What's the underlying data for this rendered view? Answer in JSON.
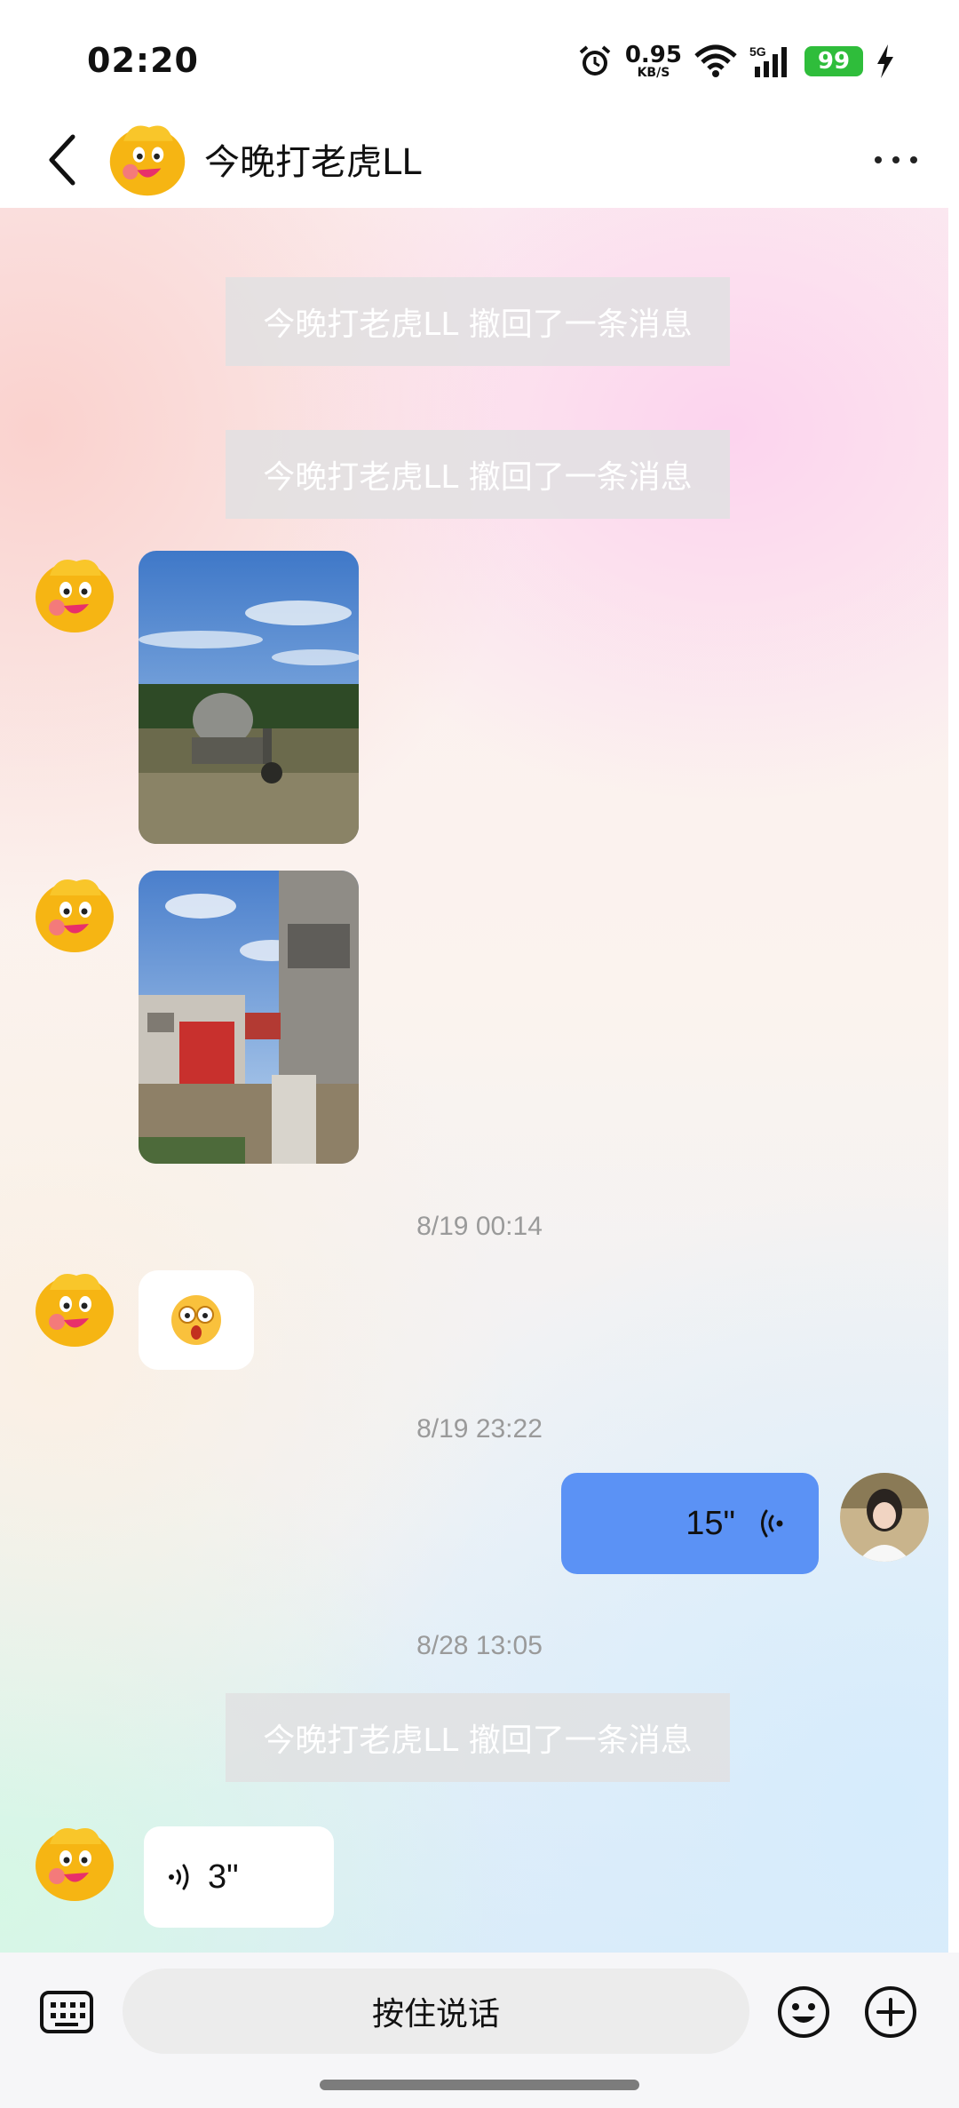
{
  "status_bar": {
    "time": "02:20",
    "speed_value": "0.95",
    "speed_unit": "KB/S",
    "network": "5G",
    "battery": "99"
  },
  "header": {
    "title": "今晚打老虎LL"
  },
  "messages": {
    "recall_1": "今晚打老虎LL 撤回了一条消息",
    "recall_2": "今晚打老虎LL 撤回了一条消息",
    "time_1": "8/19 00:14",
    "time_2": "8/19 23:22",
    "voice_out_duration": "15\"",
    "time_3": "8/28 13:05",
    "recall_3": "今晚打老虎LL 撤回了一条消息",
    "voice_in_duration": "3\""
  },
  "input_bar": {
    "hold_to_talk": "按住说话"
  },
  "icons": {
    "back": "chevron-left-icon",
    "more": "more-icon",
    "keyboard": "keyboard-icon",
    "emoji": "smile-icon",
    "add": "plus-icon"
  },
  "colors": {
    "outgoing_bubble": "#5b92f5",
    "battery": "#2fbd3b"
  }
}
